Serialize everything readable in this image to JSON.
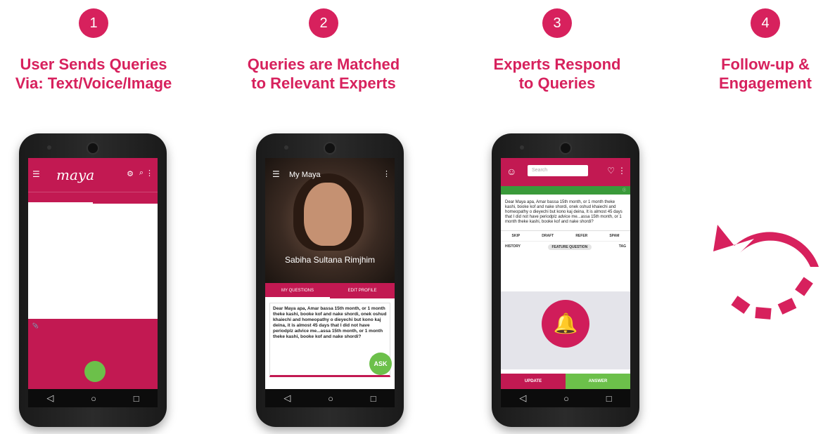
{
  "colors": {
    "accent": "#d7215d",
    "green": "#6cc04a",
    "dark": "#1a1a1a"
  },
  "steps": [
    {
      "number": "1",
      "title_line1": "User Sends Queries",
      "title_line2": "Via: Text/Voice/Image"
    },
    {
      "number": "2",
      "title_line1": "Queries are Matched",
      "title_line2": "to Relevant Experts"
    },
    {
      "number": "3",
      "title_line1": "Experts Respond",
      "title_line2": "to Queries"
    },
    {
      "number": "4",
      "title_line1": "Follow-up &",
      "title_line2": "Engagement"
    }
  ],
  "phone2": {
    "title": "My Maya",
    "name": "Sabiha Sultana Rimjhim",
    "tab_questions": "MY QUESTIONS",
    "tab_edit": "EDIT PROFILE",
    "message": "Dear Maya apa, Amar bassa 15th month, or 1 month theke kashi, booke kof and nake shordi, onek oshud khaiechi and homeopathy o dieyechi but kono kaj deina, it is almost 45 days that I did not have periodplz advice me...assa 15th month, or 1 month theke kashi, booke kof and nake shordi?",
    "fab": "ASK"
  },
  "phone3": {
    "search_placeholder": "Search",
    "message": "Dear Maya apa, Amar bassa 15th month, or 1 month theke kashi, booke kof and nake shordi, onek oshud khaiechi and homeopathy o dieyechi but kono kaj deina, It is almost 45 days that I did not have periodplz advice me...assa 15th month, or 1 month theke kashi, booke kof and nake shordi?",
    "action_skip": "SKIP",
    "action_draft": "DRAFT",
    "action_refer": "REFER",
    "action_spam": "SPAM",
    "action_history": "HISTORY",
    "action_feature": "FEATURE QUESTION",
    "action_tag": "TAG",
    "btn_update": "UPDATE",
    "btn_answer": "ANSWER"
  }
}
